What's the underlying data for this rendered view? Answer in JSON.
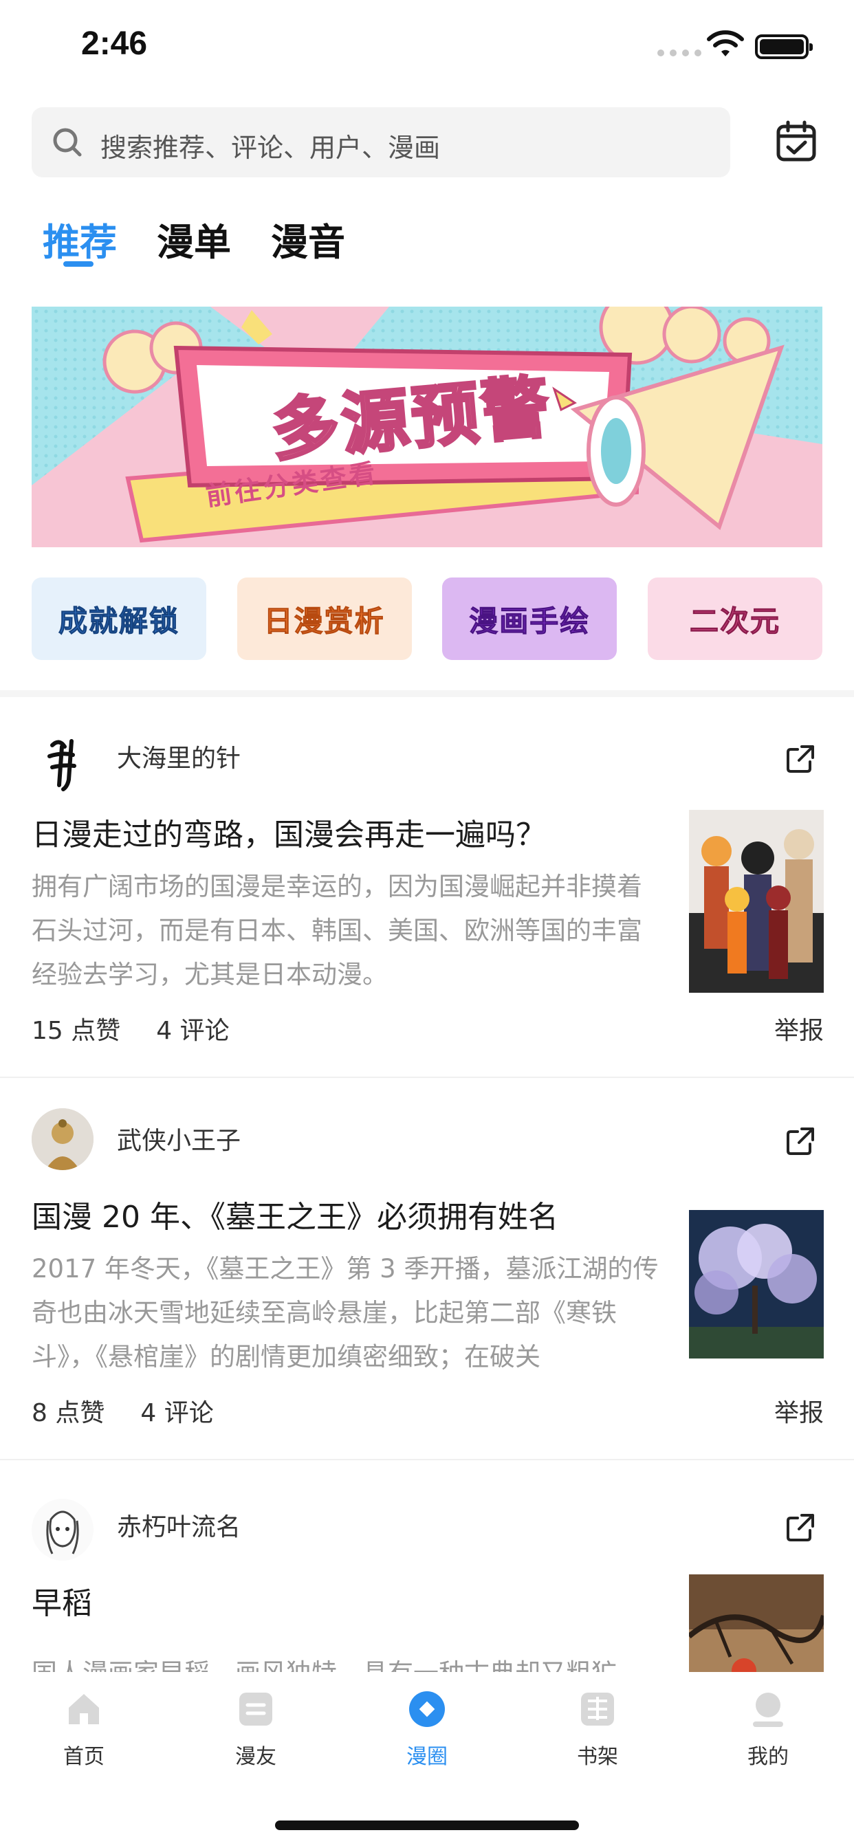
{
  "status_bar": {
    "time": "2:46"
  },
  "search": {
    "placeholder": "搜索推荐、评论、用户、漫画"
  },
  "tabs": [
    {
      "label": "推荐",
      "active": true
    },
    {
      "label": "漫单",
      "active": false
    },
    {
      "label": "漫音",
      "active": false
    }
  ],
  "banner": {
    "title": "多源预警",
    "subtitle": "前往分类查看"
  },
  "categories": [
    {
      "label": "成就解锁"
    },
    {
      "label": "日漫赏析"
    },
    {
      "label": "漫画手绘"
    },
    {
      "label": "二次元"
    }
  ],
  "posts": [
    {
      "author": "大海里的针",
      "title": "日漫走过的弯路，国漫会再走一遍吗？",
      "excerpt": "拥有广阔市场的国漫是幸运的，因为国漫崛起并非摸着石头过河，而是有日本、韩国、美国、欧洲等国的丰富经验去学习，尤其是日本动漫。",
      "likes": "15 点赞",
      "comments": "4 评论",
      "report": "举报"
    },
    {
      "author": "武侠小王子",
      "title": "国漫 20 年、《墓王之王》必须拥有姓名",
      "excerpt": "2017 年冬天，《墓王之王》第 3 季开播，墓派江湖的传奇也由冰天雪地延续至高岭悬崖，比起第二部《寒铁斗》，《悬棺崖》的剧情更加缜密细致；在破关",
      "likes": "8 点赞",
      "comments": "4 评论",
      "report": "举报"
    },
    {
      "author": "赤朽叶流名",
      "title": "早稻",
      "excerpt": "国人漫画家早稻，画风独特，具有一种古典却又粗犷"
    }
  ],
  "tabbar": [
    {
      "label": "首页",
      "icon": "home-icon",
      "active": false
    },
    {
      "label": "漫友",
      "icon": "friends-icon",
      "active": false
    },
    {
      "label": "漫圈",
      "icon": "circle-icon",
      "active": true
    },
    {
      "label": "书架",
      "icon": "bookshelf-icon",
      "active": false
    },
    {
      "label": "我的",
      "icon": "profile-icon",
      "active": false
    }
  ],
  "colors": {
    "accent": "#2b8ff0",
    "text": "#1c1c1c",
    "muted": "#999999"
  }
}
